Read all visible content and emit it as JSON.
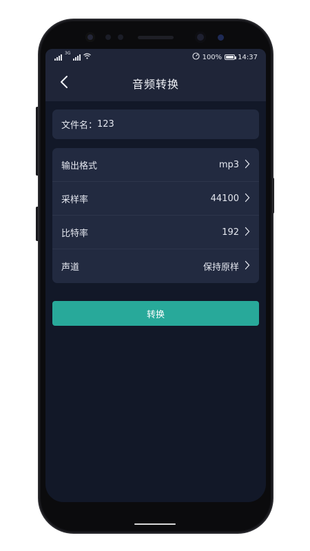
{
  "statusbar": {
    "net_label": "3G",
    "battery_pct": "100%",
    "time": "14:37",
    "icons": [
      "signal-icon",
      "wifi-icon",
      "speedometer-icon",
      "battery-icon"
    ]
  },
  "header": {
    "title": "音频转换",
    "back_icon": "chevron-left-icon"
  },
  "file": {
    "label": "文件名：",
    "value": "123"
  },
  "settings": [
    {
      "label": "输出格式",
      "value": "mp3"
    },
    {
      "label": "采样率",
      "value": "44100"
    },
    {
      "label": "比特率",
      "value": "192"
    },
    {
      "label": "声道",
      "value": "保持原样"
    }
  ],
  "actions": {
    "convert_label": "转换"
  },
  "colors": {
    "background": "#121828",
    "card": "#222a40",
    "header": "#1f2538",
    "accent": "#28a99a",
    "text": "#e4e7ef"
  }
}
